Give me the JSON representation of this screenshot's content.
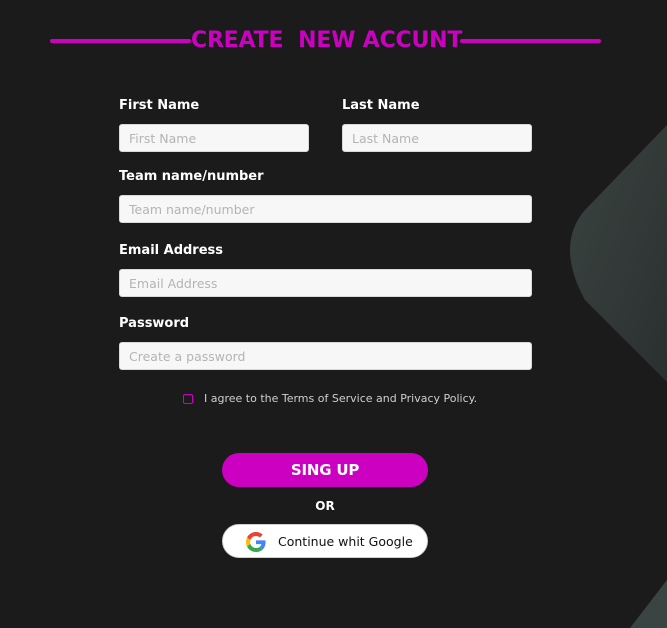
{
  "title": "CREATE  NEW ACCUNT",
  "form": {
    "first_name": {
      "label": "First Name",
      "placeholder": "First Name",
      "value": ""
    },
    "last_name": {
      "label": "Last Name",
      "placeholder": "Last Name",
      "value": ""
    },
    "team": {
      "label": "Team name/number",
      "placeholder": "Team name/number",
      "value": ""
    },
    "email": {
      "label": "Email Address",
      "placeholder": "Email Address",
      "value": ""
    },
    "password": {
      "label": "Password",
      "placeholder": "Create a password",
      "value": ""
    }
  },
  "agreement": {
    "text": "I agree to the Terms of Service and Privacy Policy.",
    "checked": false
  },
  "buttons": {
    "signup": "SING UP",
    "or": "OR",
    "google": "Continue whit Google"
  },
  "icons": {
    "google": "google-logo-icon",
    "checkbox": "checkbox-icon"
  },
  "colors": {
    "accent": "#cc00c0",
    "background": "#1b1b1c",
    "decor": "#3a4543"
  }
}
